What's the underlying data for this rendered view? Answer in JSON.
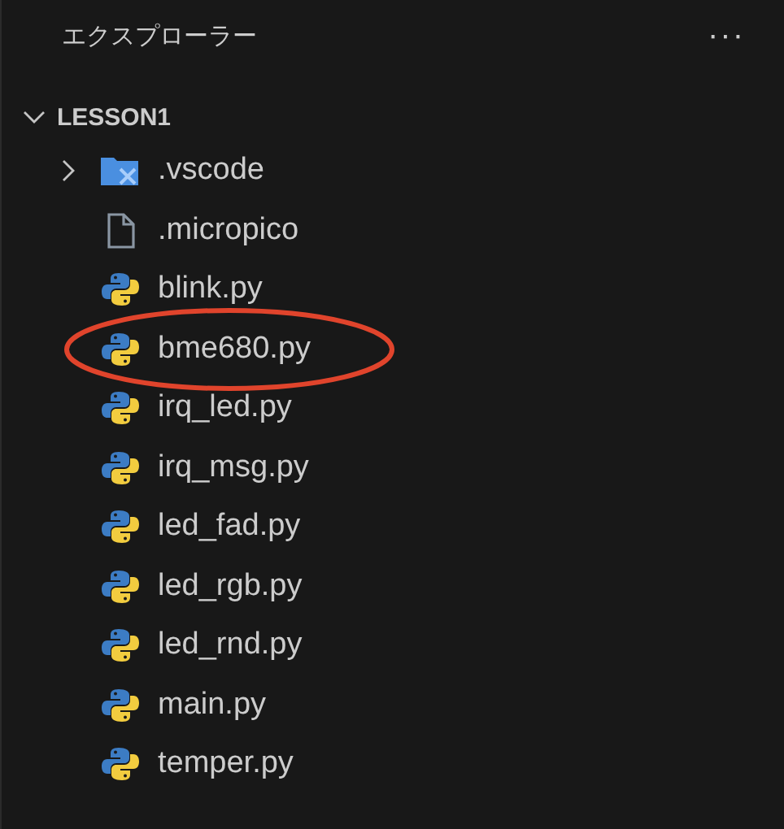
{
  "panel": {
    "title": "エクスプローラー",
    "more": "···"
  },
  "section": {
    "label": "LESSON1",
    "expanded": true
  },
  "items": [
    {
      "kind": "folder",
      "name": ".vscode",
      "expanded": false,
      "circled": false
    },
    {
      "kind": "file",
      "name": ".micropico",
      "circled": false
    },
    {
      "kind": "python",
      "name": "blink.py",
      "circled": false
    },
    {
      "kind": "python",
      "name": "bme680.py",
      "circled": true
    },
    {
      "kind": "python",
      "name": "irq_led.py",
      "circled": false
    },
    {
      "kind": "python",
      "name": "irq_msg.py",
      "circled": false
    },
    {
      "kind": "python",
      "name": "led_fad.py",
      "circled": false
    },
    {
      "kind": "python",
      "name": "led_rgb.py",
      "circled": false
    },
    {
      "kind": "python",
      "name": "led_rnd.py",
      "circled": false
    },
    {
      "kind": "python",
      "name": "main.py",
      "circled": false
    },
    {
      "kind": "python",
      "name": "temper.py",
      "circled": false
    }
  ]
}
